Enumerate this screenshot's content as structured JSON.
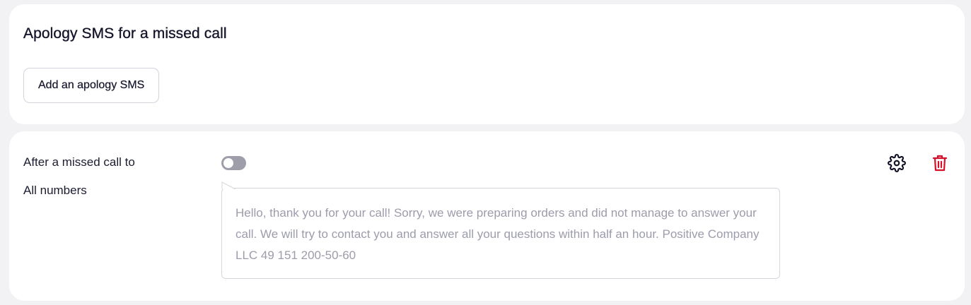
{
  "apology_section": {
    "title": "Apology SMS for a missed call",
    "add_button_label": "Add an apology SMS"
  },
  "rule": {
    "condition_label": "After a missed call to",
    "target_label": "All numbers",
    "enabled": false,
    "message": "Hello, thank you for your call! Sorry, we were preparing orders and did not manage to answer your call. We will try to contact you and answer all your questions within half an hour. Positive Company LLC 49 151 200-50-60"
  },
  "icons": {
    "settings": "gear-icon",
    "delete": "trash-icon"
  },
  "colors": {
    "page_background": "#f2f2f5",
    "card_background": "#ffffff",
    "toggle_off": "#9e9eab",
    "delete_red": "#d4102a",
    "message_text": "#9c9cab"
  }
}
